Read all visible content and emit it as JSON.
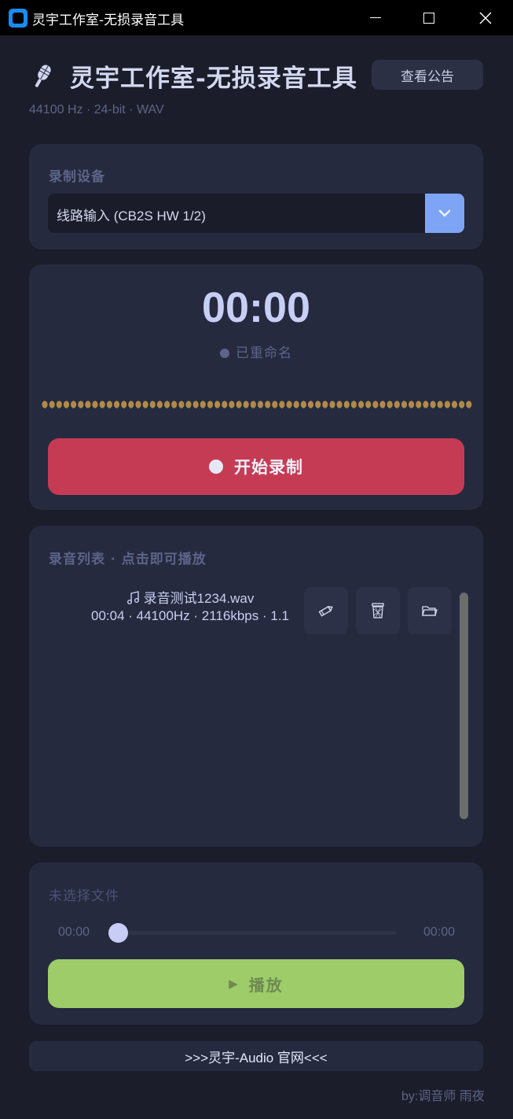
{
  "window": {
    "title": "灵宇工作室-无损录音工具"
  },
  "header": {
    "app_title": "灵宇工作室-无损录音工具",
    "notice_button": "查看公告",
    "format_info": "44100 Hz · 24-bit · WAV",
    "icon": "microphone-icon"
  },
  "device": {
    "label": "录制设备",
    "selected": "线路输入 (CB2S HW 1/2)"
  },
  "recorder": {
    "timer": "00:00",
    "status": "已重命名",
    "record_button": "开始录制"
  },
  "recordings": {
    "label": "录音列表 · 点击即可播放",
    "items": [
      {
        "name": "录音测试1234.wav",
        "meta": "00:04 · 44100Hz · 2116kbps · 1.1"
      }
    ]
  },
  "player": {
    "file_label": "未选择文件",
    "current_time": "00:00",
    "total_time": "00:00",
    "progress": 0,
    "play_button": "播放"
  },
  "footer": {
    "website_button": ">>>灵宇-Audio 官网<<<",
    "author": "by:调音师 雨夜"
  },
  "colors": {
    "background": "#1c1d2a",
    "card": "#252a3f",
    "record_accent": "#c63b54",
    "play_accent": "#9dcc68",
    "select_accent": "#7ea5f5",
    "meter_dots": "#b08a48"
  }
}
